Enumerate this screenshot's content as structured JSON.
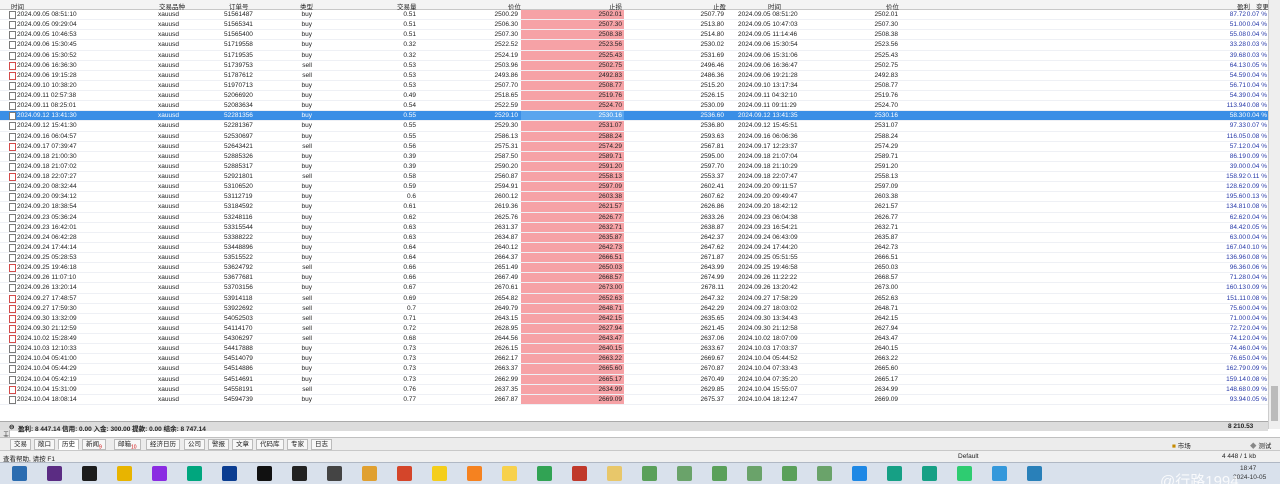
{
  "columns": {
    "time": "时间",
    "symbol": "交易品种",
    "ticket": "订单号",
    "type": "类型",
    "volume": "交易量",
    "price": "价位",
    "sl": "止损",
    "tp": "止盈",
    "close_time": "时间",
    "close_price": "价位",
    "profit": "盈利",
    "change": "变更"
  },
  "rows": [
    {
      "time": "2024.09.05 08:51:10",
      "symbol": "xauusd",
      "ticket": "51561487",
      "type": "buy",
      "volume": "0.51",
      "price": "2500.29",
      "sl": "2502.01",
      "tp": "2507.79",
      "close_time": "2024.09.05 08:51:20",
      "close_price": "2502.01",
      "profit": "87.72",
      "change": "0.07 %"
    },
    {
      "time": "2024.09.05 09:29:04",
      "symbol": "xauusd",
      "ticket": "51565341",
      "type": "buy",
      "volume": "0.51",
      "price": "2506.30",
      "sl": "2507.30",
      "tp": "2513.80",
      "close_time": "2024.09.05 10:47:03",
      "close_price": "2507.30",
      "profit": "51.00",
      "change": "0.04 %"
    },
    {
      "time": "2024.09.05 10:46:53",
      "symbol": "xauusd",
      "ticket": "51565400",
      "type": "buy",
      "volume": "0.51",
      "price": "2507.30",
      "sl": "2508.38",
      "tp": "2514.80",
      "close_time": "2024.09.05 11:14:46",
      "close_price": "2508.38",
      "profit": "55.08",
      "change": "0.04 %"
    },
    {
      "time": "2024.09.06 15:30:45",
      "symbol": "xauusd",
      "ticket": "51719558",
      "type": "buy",
      "volume": "0.32",
      "price": "2522.52",
      "sl": "2523.56",
      "tp": "2530.02",
      "close_time": "2024.09.06 15:30:54",
      "close_price": "2523.56",
      "profit": "33.28",
      "change": "0.03 %"
    },
    {
      "time": "2024.09.06 15:30:52",
      "symbol": "xauusd",
      "ticket": "51719535",
      "type": "buy",
      "volume": "0.32",
      "price": "2524.19",
      "sl": "2525.43",
      "tp": "2531.69",
      "close_time": "2024.09.06 15:31:06",
      "close_price": "2525.43",
      "profit": "39.68",
      "change": "0.03 %"
    },
    {
      "time": "2024.09.06 16:36:30",
      "symbol": "xauusd",
      "ticket": "51739753",
      "type": "sell",
      "volume": "0.53",
      "price": "2503.96",
      "sl": "2502.75",
      "tp": "2496.46",
      "close_time": "2024.09.06 16:36:47",
      "close_price": "2502.75",
      "profit": "64.13",
      "change": "0.05 %"
    },
    {
      "time": "2024.09.06 19:15:28",
      "symbol": "xauusd",
      "ticket": "51787612",
      "type": "sell",
      "volume": "0.53",
      "price": "2493.86",
      "sl": "2492.83",
      "tp": "2486.36",
      "close_time": "2024.09.06 19:21:28",
      "close_price": "2492.83",
      "profit": "54.59",
      "change": "0.04 %"
    },
    {
      "time": "2024.09.10 10:38:20",
      "symbol": "xauusd",
      "ticket": "51970713",
      "type": "buy",
      "volume": "0.53",
      "price": "2507.70",
      "sl": "2508.77",
      "tp": "2515.20",
      "close_time": "2024.09.10 13:17:34",
      "close_price": "2508.77",
      "profit": "56.71",
      "change": "0.04 %"
    },
    {
      "time": "2024.09.11 02:57:38",
      "symbol": "xauusd",
      "ticket": "52066920",
      "type": "buy",
      "volume": "0.49",
      "price": "2518.65",
      "sl": "2519.76",
      "tp": "2526.15",
      "close_time": "2024.09.11 04:32:10",
      "close_price": "2519.76",
      "profit": "54.39",
      "change": "0.04 %"
    },
    {
      "time": "2024.09.11 08:25:01",
      "symbol": "xauusd",
      "ticket": "52083634",
      "type": "buy",
      "volume": "0.54",
      "price": "2522.59",
      "sl": "2524.70",
      "tp": "2530.09",
      "close_time": "2024.09.11 09:11:29",
      "close_price": "2524.70",
      "profit": "113.94",
      "change": "0.08 %"
    },
    {
      "time": "2024.09.12 13:41:30",
      "symbol": "xauusd",
      "ticket": "52281356",
      "type": "buy",
      "volume": "0.55",
      "price": "2529.10",
      "sl": "2530.16",
      "tp": "2536.60",
      "close_time": "2024.09.12 13:41:35",
      "close_price": "2530.16",
      "profit": "58.30",
      "change": "0.04 %",
      "selected": true
    },
    {
      "time": "2024.09.12 15:41:30",
      "symbol": "xauusd",
      "ticket": "52281367",
      "type": "buy",
      "volume": "0.55",
      "price": "2529.30",
      "sl": "2531.07",
      "tp": "2536.80",
      "close_time": "2024.09.12 15:45:51",
      "close_price": "2531.07",
      "profit": "97.33",
      "change": "0.07 %"
    },
    {
      "time": "2024.09.16 06:04:57",
      "symbol": "xauusd",
      "ticket": "52530697",
      "type": "buy",
      "volume": "0.55",
      "price": "2586.13",
      "sl": "2588.24",
      "tp": "2593.63",
      "close_time": "2024.09.16 06:06:36",
      "close_price": "2588.24",
      "profit": "116.05",
      "change": "0.08 %"
    },
    {
      "time": "2024.09.17 07:39:47",
      "symbol": "xauusd",
      "ticket": "52643421",
      "type": "sell",
      "volume": "0.56",
      "price": "2575.31",
      "sl": "2574.29",
      "tp": "2567.81",
      "close_time": "2024.09.17 12:23:37",
      "close_price": "2574.29",
      "profit": "57.12",
      "change": "0.04 %"
    },
    {
      "time": "2024.09.18 21:00:30",
      "symbol": "xauusd",
      "ticket": "52885326",
      "type": "buy",
      "volume": "0.39",
      "price": "2587.50",
      "sl": "2589.71",
      "tp": "2595.00",
      "close_time": "2024.09.18 21:07:04",
      "close_price": "2589.71",
      "profit": "86.19",
      "change": "0.09 %"
    },
    {
      "time": "2024.09.18 21:07:02",
      "symbol": "xauusd",
      "ticket": "52885317",
      "type": "buy",
      "volume": "0.39",
      "price": "2590.20",
      "sl": "2591.20",
      "tp": "2597.70",
      "close_time": "2024.09.18 21:10:29",
      "close_price": "2591.20",
      "profit": "39.00",
      "change": "0.04 %"
    },
    {
      "time": "2024.09.18 22:07:27",
      "symbol": "xauusd",
      "ticket": "52921801",
      "type": "sell",
      "volume": "0.58",
      "price": "2560.87",
      "sl": "2558.13",
      "tp": "2553.37",
      "close_time": "2024.09.18 22:07:47",
      "close_price": "2558.13",
      "profit": "158.92",
      "change": "0.11 %"
    },
    {
      "time": "2024.09.20 08:32:44",
      "symbol": "xauusd",
      "ticket": "53106520",
      "type": "buy",
      "volume": "0.59",
      "price": "2594.91",
      "sl": "2597.09",
      "tp": "2602.41",
      "close_time": "2024.09.20 09:11:57",
      "close_price": "2597.09",
      "profit": "128.62",
      "change": "0.09 %"
    },
    {
      "time": "2024.09.20 09:34:12",
      "symbol": "xauusd",
      "ticket": "53112719",
      "type": "buy",
      "volume": "0.6",
      "price": "2600.12",
      "sl": "2603.38",
      "tp": "2607.62",
      "close_time": "2024.09.20 09:49:47",
      "close_price": "2603.38",
      "profit": "195.60",
      "change": "0.13 %"
    },
    {
      "time": "2024.09.20 18:38:54",
      "symbol": "xauusd",
      "ticket": "53184592",
      "type": "buy",
      "volume": "0.61",
      "price": "2619.36",
      "sl": "2621.57",
      "tp": "2626.86",
      "close_time": "2024.09.20 18:42:12",
      "close_price": "2621.57",
      "profit": "134.81",
      "change": "0.08 %"
    },
    {
      "time": "2024.09.23 05:36:24",
      "symbol": "xauusd",
      "ticket": "53248116",
      "type": "buy",
      "volume": "0.62",
      "price": "2625.76",
      "sl": "2626.77",
      "tp": "2633.26",
      "close_time": "2024.09.23 06:04:38",
      "close_price": "2626.77",
      "profit": "62.62",
      "change": "0.04 %"
    },
    {
      "time": "2024.09.23 16:42:01",
      "symbol": "xauusd",
      "ticket": "53315544",
      "type": "buy",
      "volume": "0.63",
      "price": "2631.37",
      "sl": "2632.71",
      "tp": "2638.87",
      "close_time": "2024.09.23 16:54:21",
      "close_price": "2632.71",
      "profit": "84.42",
      "change": "0.05 %"
    },
    {
      "time": "2024.09.24 06:42:28",
      "symbol": "xauusd",
      "ticket": "53388222",
      "type": "buy",
      "volume": "0.63",
      "price": "2634.87",
      "sl": "2635.87",
      "tp": "2642.37",
      "close_time": "2024.09.24 06:43:09",
      "close_price": "2635.87",
      "profit": "63.00",
      "change": "0.04 %"
    },
    {
      "time": "2024.09.24 17:44:14",
      "symbol": "xauusd",
      "ticket": "53448896",
      "type": "buy",
      "volume": "0.64",
      "price": "2640.12",
      "sl": "2642.73",
      "tp": "2647.62",
      "close_time": "2024.09.24 17:44:20",
      "close_price": "2642.73",
      "profit": "167.04",
      "change": "0.10 %"
    },
    {
      "time": "2024.09.25 05:28:53",
      "symbol": "xauusd",
      "ticket": "53515522",
      "type": "buy",
      "volume": "0.64",
      "price": "2664.37",
      "sl": "2666.51",
      "tp": "2671.87",
      "close_time": "2024.09.25 05:51:55",
      "close_price": "2666.51",
      "profit": "136.96",
      "change": "0.08 %"
    },
    {
      "time": "2024.09.25 19:46:18",
      "symbol": "xauusd",
      "ticket": "53624792",
      "type": "sell",
      "volume": "0.66",
      "price": "2651.49",
      "sl": "2650.03",
      "tp": "2643.99",
      "close_time": "2024.09.25 19:46:58",
      "close_price": "2650.03",
      "profit": "96.36",
      "change": "0.06 %"
    },
    {
      "time": "2024.09.26 11:07:10",
      "symbol": "xauusd",
      "ticket": "53677681",
      "type": "buy",
      "volume": "0.66",
      "price": "2667.49",
      "sl": "2668.57",
      "tp": "2674.99",
      "close_time": "2024.09.26 11:22:22",
      "close_price": "2668.57",
      "profit": "71.28",
      "change": "0.04 %"
    },
    {
      "time": "2024.09.26 13:20:14",
      "symbol": "xauusd",
      "ticket": "53703156",
      "type": "buy",
      "volume": "0.67",
      "price": "2670.61",
      "sl": "2673.00",
      "tp": "2678.11",
      "close_time": "2024.09.26 13:20:42",
      "close_price": "2673.00",
      "profit": "160.13",
      "change": "0.09 %"
    },
    {
      "time": "2024.09.27 17:48:57",
      "symbol": "xauusd",
      "ticket": "53914118",
      "type": "sell",
      "volume": "0.69",
      "price": "2654.82",
      "sl": "2652.63",
      "tp": "2647.32",
      "close_time": "2024.09.27 17:58:29",
      "close_price": "2652.63",
      "profit": "151.11",
      "change": "0.08 %"
    },
    {
      "time": "2024.09.27 17:59:30",
      "symbol": "xauusd",
      "ticket": "53922692",
      "type": "sell",
      "volume": "0.7",
      "price": "2649.79",
      "sl": "2648.71",
      "tp": "2642.29",
      "close_time": "2024.09.27 18:03:02",
      "close_price": "2648.71",
      "profit": "75.60",
      "change": "0.04 %"
    },
    {
      "time": "2024.09.30 13:32:09",
      "symbol": "xauusd",
      "ticket": "54052503",
      "type": "sell",
      "volume": "0.71",
      "price": "2643.15",
      "sl": "2642.15",
      "tp": "2635.65",
      "close_time": "2024.09.30 13:34:43",
      "close_price": "2642.15",
      "profit": "71.00",
      "change": "0.04 %"
    },
    {
      "time": "2024.09.30 21:12:59",
      "symbol": "xauusd",
      "ticket": "54114170",
      "type": "sell",
      "volume": "0.72",
      "price": "2628.95",
      "sl": "2627.94",
      "tp": "2621.45",
      "close_time": "2024.09.30 21:12:58",
      "close_price": "2627.94",
      "profit": "72.72",
      "change": "0.04 %"
    },
    {
      "time": "2024.10.02 15:28:49",
      "symbol": "xauusd",
      "ticket": "54306297",
      "type": "sell",
      "volume": "0.68",
      "price": "2644.56",
      "sl": "2643.47",
      "tp": "2637.06",
      "close_time": "2024.10.02 18:07:09",
      "close_price": "2643.47",
      "profit": "74.12",
      "change": "0.04 %"
    },
    {
      "time": "2024.10.03 12:10:33",
      "symbol": "xauusd",
      "ticket": "54417888",
      "type": "buy",
      "volume": "0.73",
      "price": "2626.15",
      "sl": "2640.15",
      "tp": "2633.67",
      "close_time": "2024.10.03 17:03:37",
      "close_price": "2640.15",
      "profit": "74.46",
      "change": "0.04 %"
    },
    {
      "time": "2024.10.04 05:41:00",
      "symbol": "xauusd",
      "ticket": "54514079",
      "type": "buy",
      "volume": "0.73",
      "price": "2662.17",
      "sl": "2663.22",
      "tp": "2669.67",
      "close_time": "2024.10.04 05:44:52",
      "close_price": "2663.22",
      "profit": "76.65",
      "change": "0.04 %"
    },
    {
      "time": "2024.10.04 05:44:29",
      "symbol": "xauusd",
      "ticket": "54514886",
      "type": "buy",
      "volume": "0.73",
      "price": "2663.37",
      "sl": "2665.60",
      "tp": "2670.87",
      "close_time": "2024.10.04 07:33:43",
      "close_price": "2665.60",
      "profit": "162.79",
      "change": "0.09 %"
    },
    {
      "time": "2024.10.04 05:42:19",
      "symbol": "xauusd",
      "ticket": "54514691",
      "type": "buy",
      "volume": "0.73",
      "price": "2662.99",
      "sl": "2665.17",
      "tp": "2670.49",
      "close_time": "2024.10.04 07:35:20",
      "close_price": "2665.17",
      "profit": "159.14",
      "change": "0.08 %"
    },
    {
      "time": "2024.10.04 15:31:09",
      "symbol": "xauusd",
      "ticket": "54558191",
      "type": "sell",
      "volume": "0.76",
      "price": "2637.35",
      "sl": "2634.99",
      "tp": "2629.85",
      "close_time": "2024.10.04 15:55:07",
      "close_price": "2634.99",
      "profit": "148.68",
      "change": "0.09 %"
    },
    {
      "time": "2024.10.04 18:08:14",
      "symbol": "xauusd",
      "ticket": "54594739",
      "type": "buy",
      "volume": "0.77",
      "price": "2667.87",
      "sl": "2669.09",
      "tp": "2675.37",
      "close_time": "2024.10.04 18:12:47",
      "close_price": "2669.09",
      "profit": "93.94",
      "change": "0.05 %"
    }
  ],
  "summary": {
    "text": "盈利: 8 447.14  信用: 0.00  入金: 300.00  提款: 0.00  结余: 8 747.14",
    "total": "8 210.53"
  },
  "tabs": [
    {
      "label": "交易"
    },
    {
      "label": "敞口"
    },
    {
      "label": "历史",
      "active": true
    },
    {
      "label": "新闻",
      "badge": "9"
    },
    {
      "label": "邮箱",
      "badge": "10"
    },
    {
      "label": "经济日历"
    },
    {
      "label": "公司"
    },
    {
      "label": "警报"
    },
    {
      "label": "文章"
    },
    {
      "label": "代码库"
    },
    {
      "label": "专家"
    },
    {
      "label": "日志"
    }
  ],
  "right_tabs": {
    "market": "市场",
    "test": "测试"
  },
  "terminal_label": "工具箱",
  "status": {
    "help": "查看帮助, 请按 F1",
    "profile": "Default",
    "net": "4 448 / 1 kb"
  },
  "taskbar": {
    "apps": [
      "finder",
      "cpt",
      "mt4",
      "chrome",
      "premiere",
      "audition",
      "photoshop",
      "capcut",
      "penguin",
      "c4d",
      "files",
      "mail",
      "chart",
      "duck",
      "mine",
      "mine2",
      "redapp",
      "files2",
      "mt5",
      "mt5b",
      "mt5c",
      "mt5d",
      "mt5e",
      "mt5f",
      "win",
      "iam",
      "iam2",
      "play",
      "search",
      "telegram"
    ],
    "time": "18:47",
    "date": "2024-10-05"
  },
  "watermark": "@行路1994",
  "colors": {
    "sl_cell": "#f6a2a6",
    "selected": "#3a8ee6",
    "profit_text": "#2638a8"
  }
}
